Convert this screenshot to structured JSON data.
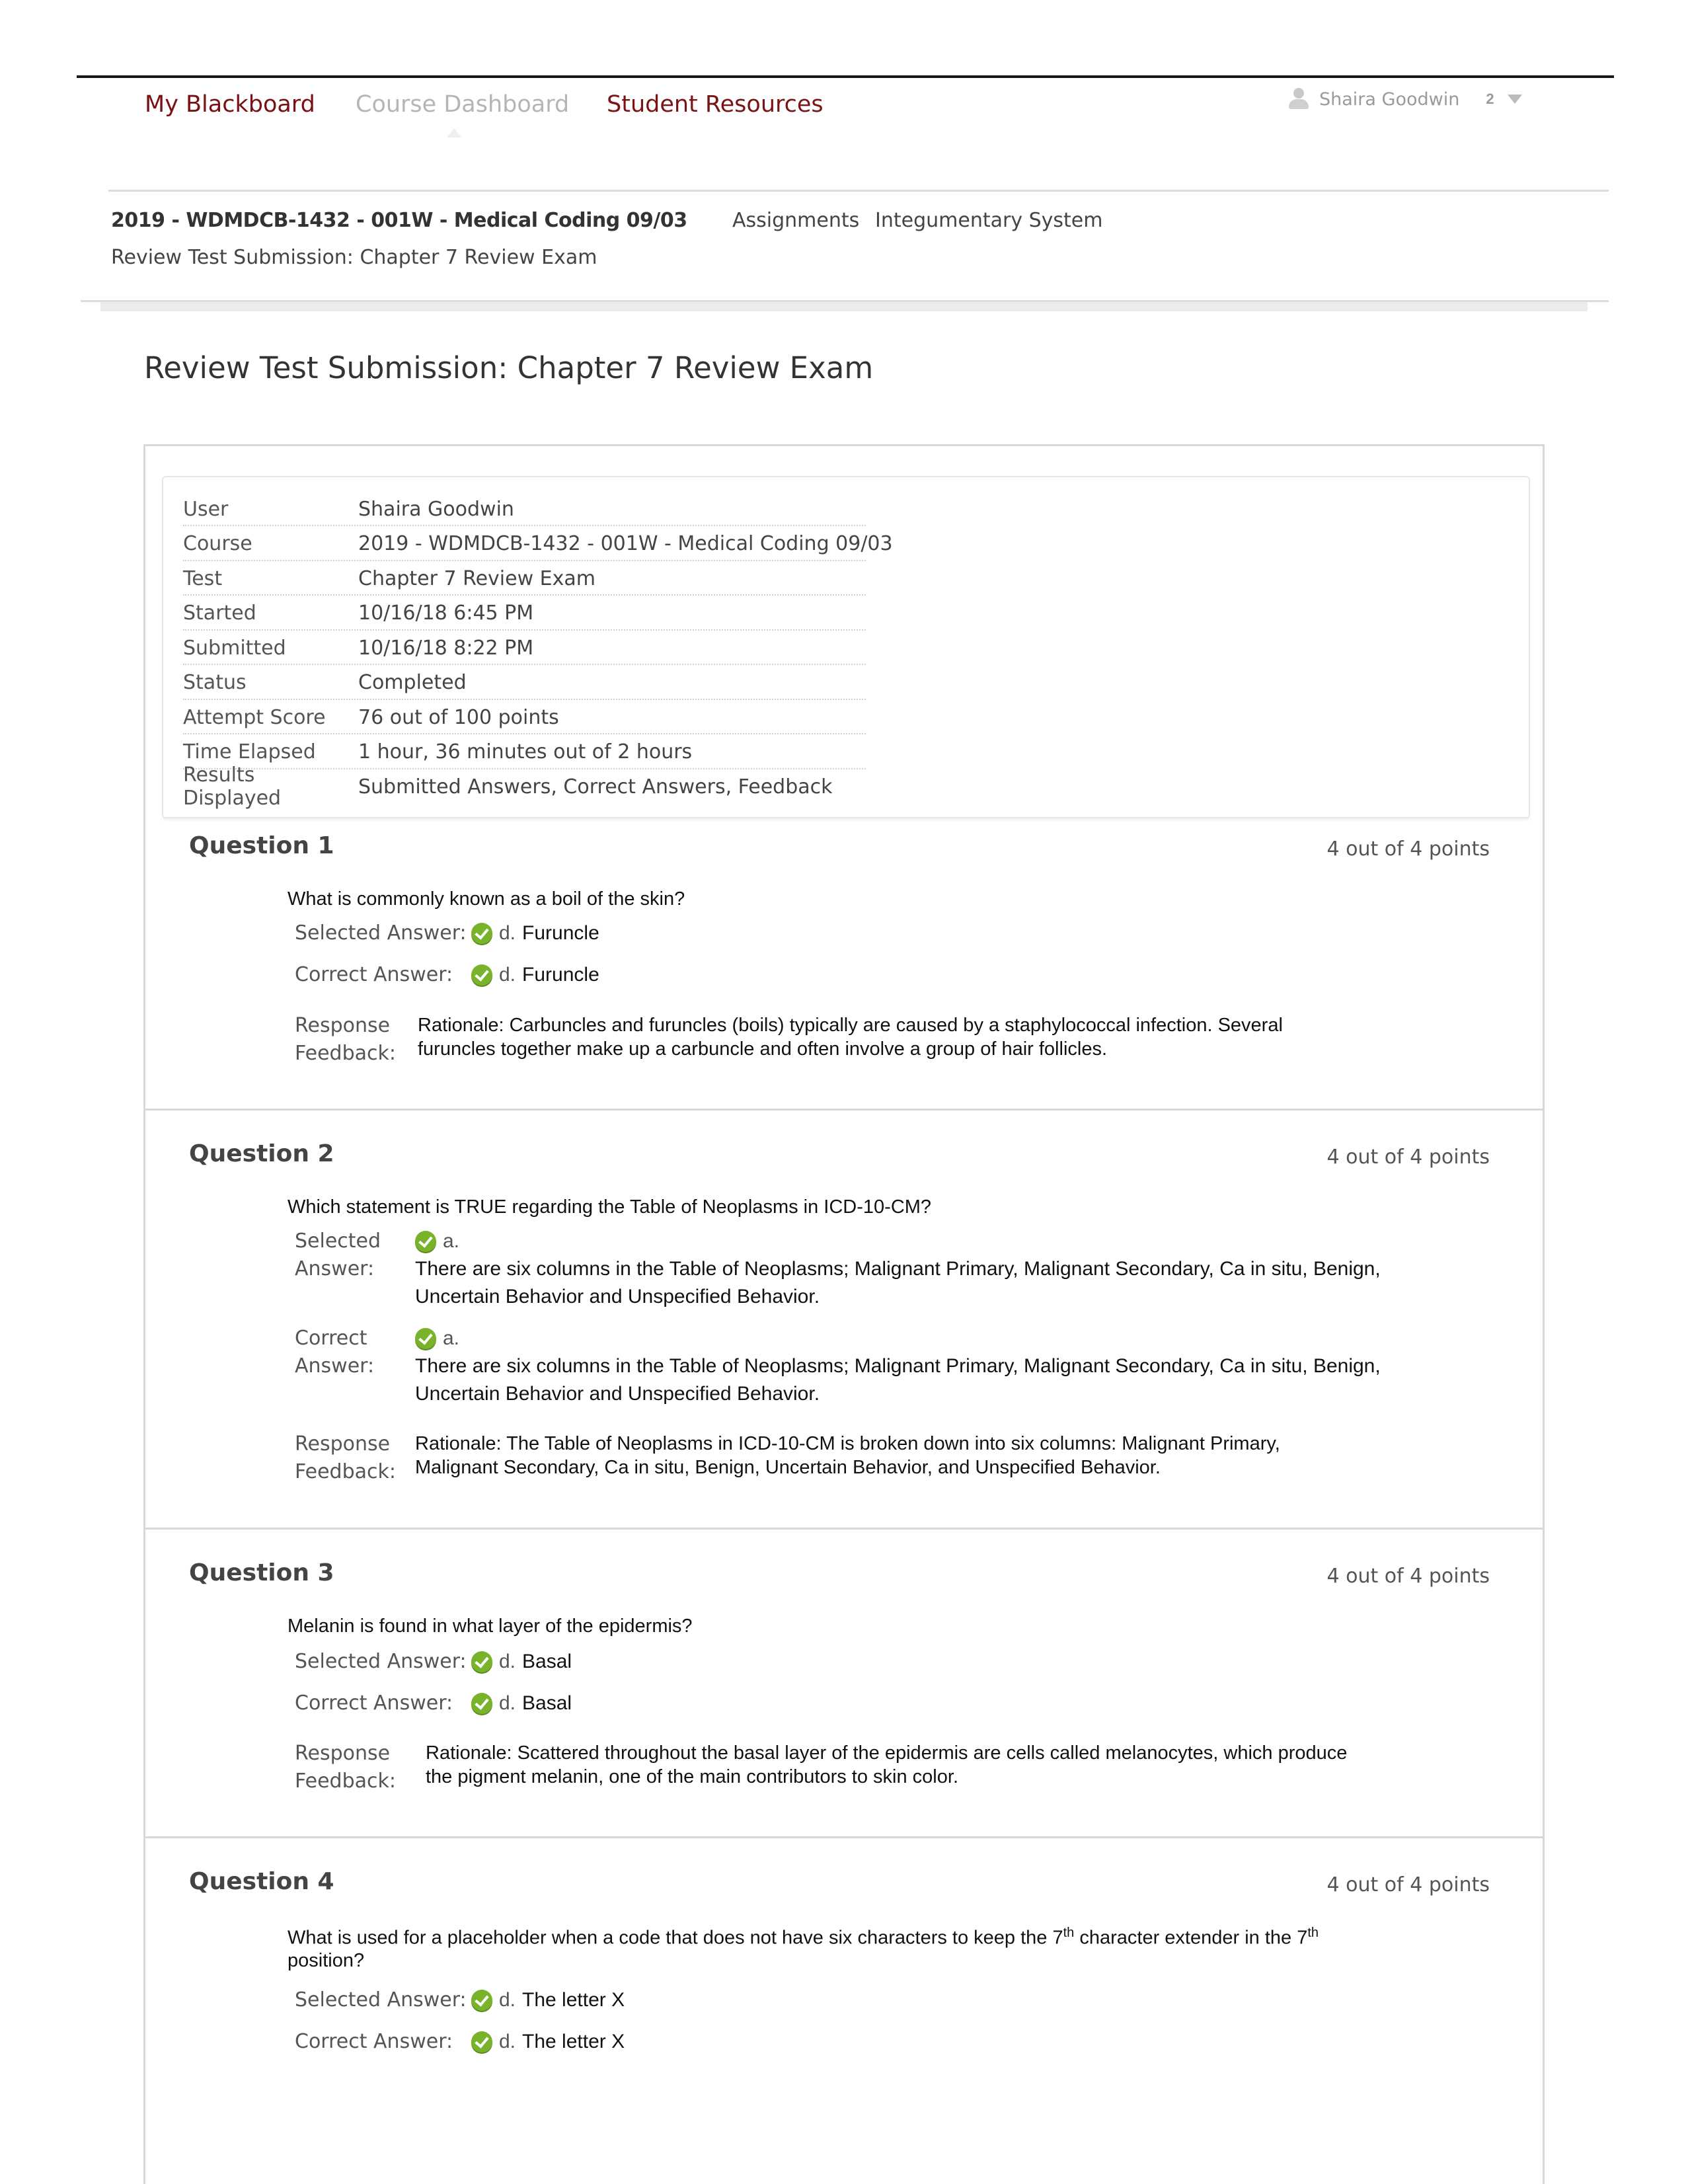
{
  "topnav": {
    "my_blackboard": "My Blackboard",
    "course_dashboard": "Course Dashboard",
    "student_resources": "Student Resources",
    "user_name": "Shaira Goodwin",
    "notification_count": "2"
  },
  "breadcrumb": {
    "course": "2019 - WDMDCB-1432 - 001W - Medical Coding 09/03",
    "assignments": "Assignments",
    "section": "Integumentary System",
    "current": "Review Test Submission: Chapter 7 Review Exam"
  },
  "page_title": "Review Test Submission: Chapter 7 Review Exam",
  "summary": [
    {
      "label": "User",
      "value": "Shaira Goodwin"
    },
    {
      "label": "Course",
      "value": "2019 - WDMDCB-1432 - 001W - Medical Coding 09/03"
    },
    {
      "label": "Test",
      "value": "Chapter 7 Review Exam"
    },
    {
      "label": "Started",
      "value": "10/16/18 6:45 PM"
    },
    {
      "label": "Submitted",
      "value": "10/16/18 8:22 PM"
    },
    {
      "label": "Status",
      "value": "Completed"
    },
    {
      "label": "Attempt Score",
      "value": "76 out of 100 points"
    },
    {
      "label": "Time Elapsed",
      "value": "1 hour, 36 minutes out of 2 hours"
    },
    {
      "label": "Results Displayed",
      "value": "Submitted Answers, Correct Answers, Feedback"
    }
  ],
  "labels": {
    "selected_answer": "Selected Answer:",
    "correct_answer": "Correct Answer:",
    "selected": "Selected",
    "correct": "Correct",
    "answer": "Answer:",
    "response": "Response",
    "feedback": "Feedback:"
  },
  "questions": [
    {
      "title": "Question 1",
      "points": "4 out of 4 points",
      "text": "What is commonly known as a boil of the skin?",
      "selected_letter": "d.",
      "selected_answer": "Furuncle",
      "correct_letter": "d.",
      "correct_answer": "Furuncle",
      "feedback_line1": "Rationale:  Carbuncles and furuncles (boils) typically are caused by a staphylococcal infection. Several",
      "feedback_line2": "furuncles together make up a carbuncle and often involve a group of hair follicles."
    },
    {
      "title": "Question 2",
      "points": "4 out of 4 points",
      "text": "Which statement is TRUE regarding the Table of Neoplasms in ICD-10-CM?",
      "selected_letter": "a.",
      "selected_line1": "There are six columns in the Table of Neoplasms; Malignant Primary, Malignant Secondary, Ca in situ, Benign,",
      "selected_line2": "Uncertain Behavior and Unspecified Behavior.",
      "correct_letter": "a.",
      "correct_line1": "There are six columns in the Table of Neoplasms; Malignant Primary, Malignant Secondary, Ca in situ, Benign,",
      "correct_line2": "Uncertain Behavior and Unspecified Behavior.",
      "feedback_line1": "Rationale:  The Table of Neoplasms in ICD-10-CM is broken down into six columns: Malignant Primary,",
      "feedback_line2": "Malignant Secondary, Ca in situ, Benign, Uncertain Behavior, and Unspecified Behavior."
    },
    {
      "title": "Question 3",
      "points": "4 out of 4 points",
      "text": "Melanin is found in what layer of the epidermis?",
      "selected_letter": "d.",
      "selected_answer": "Basal",
      "correct_letter": "d.",
      "correct_answer": "Basal",
      "feedback_line1": "Rationale:  Scattered throughout the basal layer of the epidermis are cells called melanocytes, which produce",
      "feedback_line2": "the pigment melanin, one of the main contributors to skin color."
    },
    {
      "title": "Question 4",
      "points": "4 out of 4 points",
      "text_part1": "What is used for a placeholder when a code that does not have six characters to keep the 7",
      "sup1": "th",
      "text_part2": " character extender in the 7",
      "sup2": "th",
      "text_part3": "position?",
      "selected_letter": "d.",
      "selected_answer": "The letter X",
      "correct_letter": "d.",
      "correct_answer": "The letter X"
    }
  ]
}
